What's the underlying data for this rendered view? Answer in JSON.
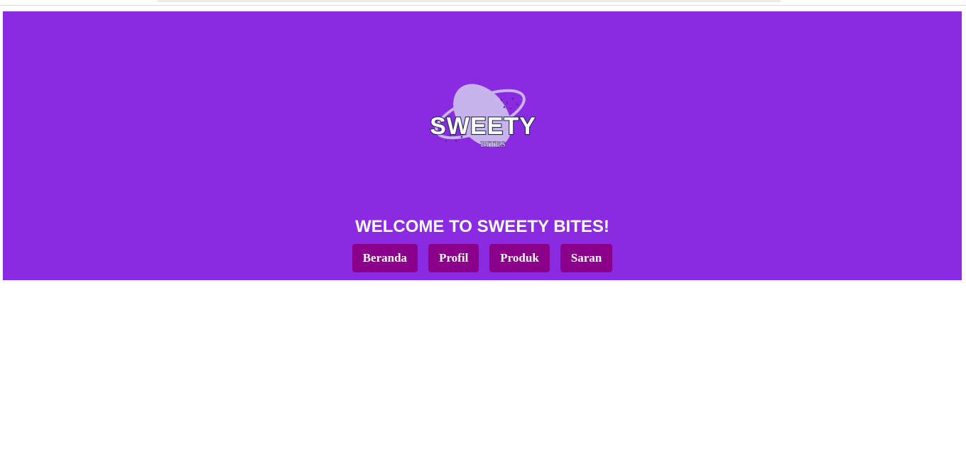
{
  "page": {
    "background": "#ffffff"
  },
  "hero": {
    "background": "#8a2be2",
    "logo": {
      "icon": "sweety-bites-logo",
      "text_main": "SWEETY",
      "text_sub": "BITES"
    },
    "welcome_text": "WELCOME TO SWEETY BITES!"
  },
  "nav": {
    "button_color": "#8b008b",
    "items": [
      {
        "label": "Beranda"
      },
      {
        "label": "Profil"
      },
      {
        "label": "Produk"
      },
      {
        "label": "Saran"
      }
    ]
  }
}
